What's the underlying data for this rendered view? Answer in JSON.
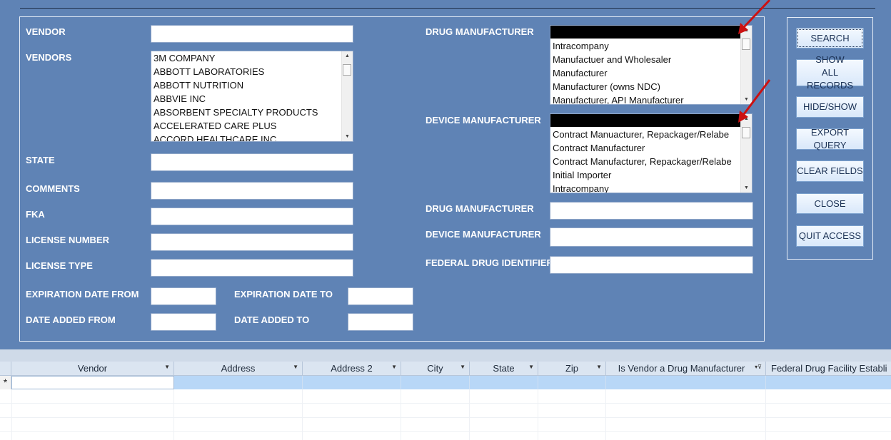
{
  "form": {
    "labels": {
      "vendor": "VENDOR",
      "vendors": "VENDORS",
      "state": "STATE",
      "comments": "COMMENTS",
      "fka": "FKA",
      "license_number": "LICENSE NUMBER",
      "license_type": "LICENSE TYPE",
      "expiration_date_from": "EXPIRATION DATE FROM",
      "expiration_date_to": "EXPIRATION DATE TO",
      "date_added_from": "DATE ADDED FROM",
      "date_added_to": "DATE ADDED TO",
      "drug_manufacturer_list": "DRUG MANUFACTURER",
      "device_manufacturer_list": "DEVICE MANUFACTURER",
      "drug_manufacturer": "DRUG MANUFACTURER",
      "device_manufacturer": "DEVICE MANUFACTURER",
      "federal_drug_identifier": "FEDERAL DRUG IDENTIFIER"
    },
    "vendors_list": [
      "3M COMPANY",
      "ABBOTT LABORATORIES",
      "ABBOTT NUTRITION",
      "ABBVIE INC",
      "ABSORBENT SPECIALTY PRODUCTS",
      "ACCELERATED CARE PLUS",
      "ACCORD HEALTHCARE INC"
    ],
    "drug_manufacturer_list": [
      "Intracompany",
      "Manufactuer and Wholesaler",
      "Manufacturer",
      "Manufacturer (owns NDC)",
      "Manufacturer, API Manufacturer"
    ],
    "device_manufacturer_list": [
      "Contract Manuacturer, Repackager/Relabe",
      "Contract Manufacturer",
      "Contract Manufacturer, Repackager/Relabe",
      "Initial Importer",
      "Intracompany"
    ],
    "arrow_color": "#cc1111"
  },
  "buttons": {
    "search": "SEARCH",
    "show_all_records": "SHOW ALL RECORDS",
    "hide_show": "HIDE/SHOW",
    "export_query": "EXPORT QUERY",
    "clear_fields": "CLEAR FIELDS",
    "close": "CLOSE",
    "quit_access": "QUIT ACCESS"
  },
  "datasheet": {
    "columns": [
      "Vendor",
      "Address",
      "Address 2",
      "City",
      "State",
      "Zip",
      "Is Vendor a Drug Manufacturer",
      "Federal Drug Facility Establi"
    ],
    "new_record_marker": "*"
  },
  "colors": {
    "background": "#5f83b5",
    "selected_row": "#b8d7f7",
    "header_bg": "#dbe5f1"
  }
}
